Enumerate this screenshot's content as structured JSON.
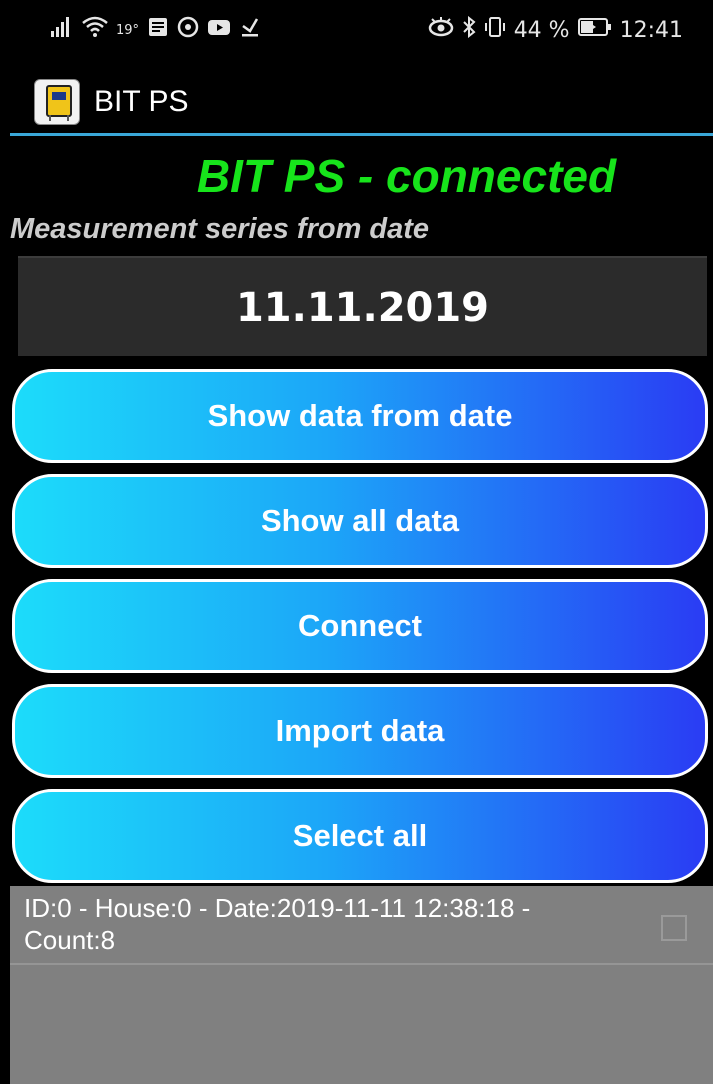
{
  "status_bar": {
    "temperature": "19°",
    "battery_percent": "44 %",
    "time": "12:41",
    "icons_left": [
      "signal-icon",
      "wifi-icon",
      "notification-icon",
      "whatsapp-icon",
      "youtube-icon",
      "download-icon"
    ],
    "icons_right": [
      "eye-icon",
      "bluetooth-icon",
      "vibrate-icon",
      "battery-icon"
    ]
  },
  "action_bar": {
    "title": "BIT PS",
    "accent_color": "#3aa7d8"
  },
  "main": {
    "connection_status": "BIT PS - connected",
    "connection_color": "#17e41b",
    "series_label": "Measurement series from date",
    "date_value": "11.11.2019"
  },
  "buttons": {
    "show_from_date": "Show data from date",
    "show_all": "Show all data",
    "connect": "Connect",
    "import": "Import data",
    "select_all": "Select all",
    "gradient_start": "#1cdcfa",
    "gradient_end": "#2a3cf4"
  },
  "list": {
    "items": [
      {
        "text": "ID:0 - House:0 - Date:2019-11-11 12:38:18 - Count:8",
        "checked": false
      }
    ]
  }
}
